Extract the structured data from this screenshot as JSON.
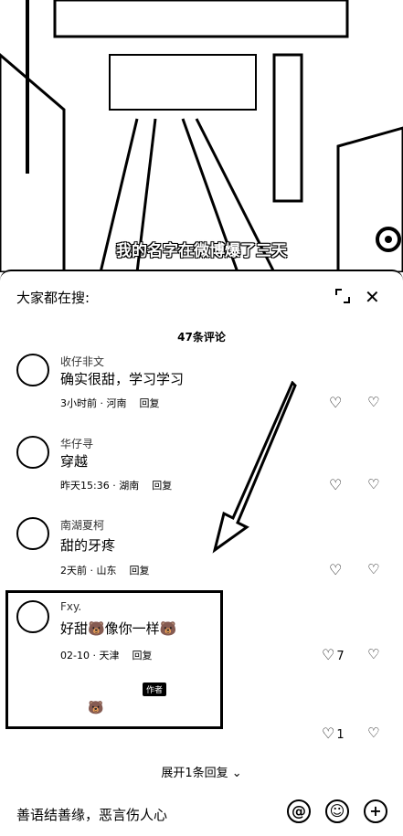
{
  "video": {
    "subtitle": "我的名字在微博爆了三天"
  },
  "panel": {
    "search_label": "大家都在搜:",
    "comment_count": "47条评论",
    "comments": [
      {
        "user": "收仔非文",
        "text": "确实很甜，学习学习",
        "time": "3小时前 · 河南",
        "reply": "回复",
        "likes": ""
      },
      {
        "user": "华仔寻",
        "text": "穿越",
        "time": "昨天15:36 · 湖南",
        "reply": "回复",
        "likes": ""
      },
      {
        "user": "南湖夏柯",
        "text": "甜的牙疼",
        "time": "2天前 · 山东",
        "reply": "回复",
        "likes": ""
      },
      {
        "user": "Fxy.",
        "text": "好甜🐻像你一样🐻",
        "time": "02-10 · 天津",
        "reply": "回复",
        "likes": "7"
      }
    ],
    "author_tag": "作者",
    "sub_reply_likes": "1",
    "expand_replies": "展开1条回复",
    "input_placeholder": "善语结善缘，恶言伤人心"
  }
}
